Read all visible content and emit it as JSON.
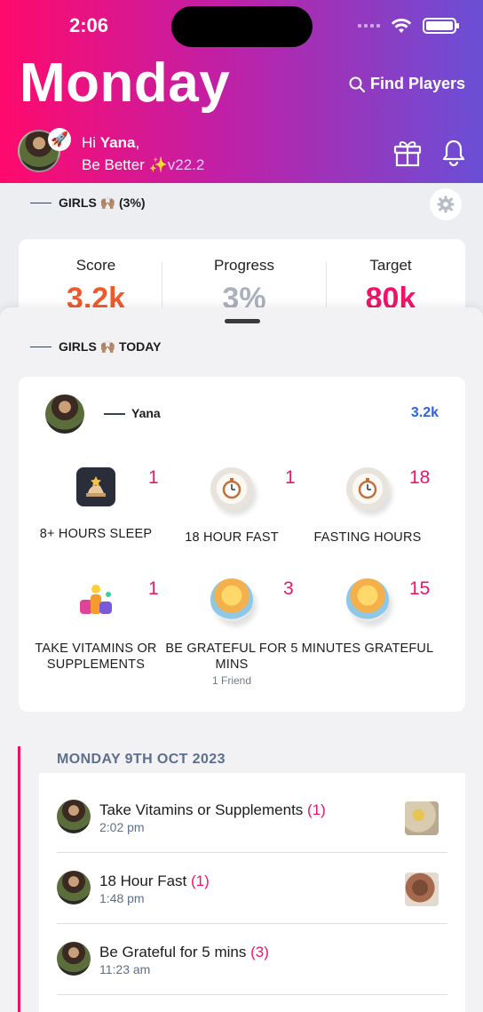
{
  "status_bar": {
    "time": "2:06"
  },
  "header": {
    "day": "Monday",
    "find_players": "Find Players",
    "greeting_prefix": "Hi ",
    "greeting_name": "Yana",
    "greeting_suffix": ",",
    "tagline": "Be Better ✨",
    "version": "v22.2"
  },
  "group": {
    "label": "GIRLS 🙌🏽 (3%)"
  },
  "stats": {
    "score_label": "Score",
    "score_value": "3.2k",
    "progress_label": "Progress",
    "progress_value": "3%",
    "target_label": "Target",
    "target_value": "80k"
  },
  "today": {
    "label": "GIRLS 🙌🏽 TODAY",
    "user_name": "Yana",
    "user_score": "3.2k",
    "activities": [
      {
        "count": "1",
        "name": "8+ HOURS SLEEP",
        "sub": ""
      },
      {
        "count": "1",
        "name": "18 HOUR FAST",
        "sub": ""
      },
      {
        "count": "18",
        "name": "FASTING HOURS",
        "sub": ""
      },
      {
        "count": "1",
        "name": "TAKE VITAMINS OR SUPPLEMENTS",
        "sub": ""
      },
      {
        "count": "3",
        "name": "BE GRATEFUL FOR 5 MINS",
        "sub": "1 Friend"
      },
      {
        "count": "15",
        "name": "MINUTES GRATEFUL",
        "sub": ""
      }
    ]
  },
  "feed": {
    "date": "MONDAY 9TH OCT 2023",
    "items": [
      {
        "title": "Take Vitamins or Supplements",
        "count": "(1)",
        "time": "2:02 pm"
      },
      {
        "title": "18 Hour Fast",
        "count": "(1)",
        "time": "1:48 pm"
      },
      {
        "title": "Be Grateful for 5 mins",
        "count": "(3)",
        "time": "11:23 am"
      }
    ]
  },
  "colors": {
    "accent_pink": "#ef1468",
    "score_orange": "#f05a2a",
    "progress_gray": "#aab0bc",
    "blue": "#2d62e0"
  }
}
